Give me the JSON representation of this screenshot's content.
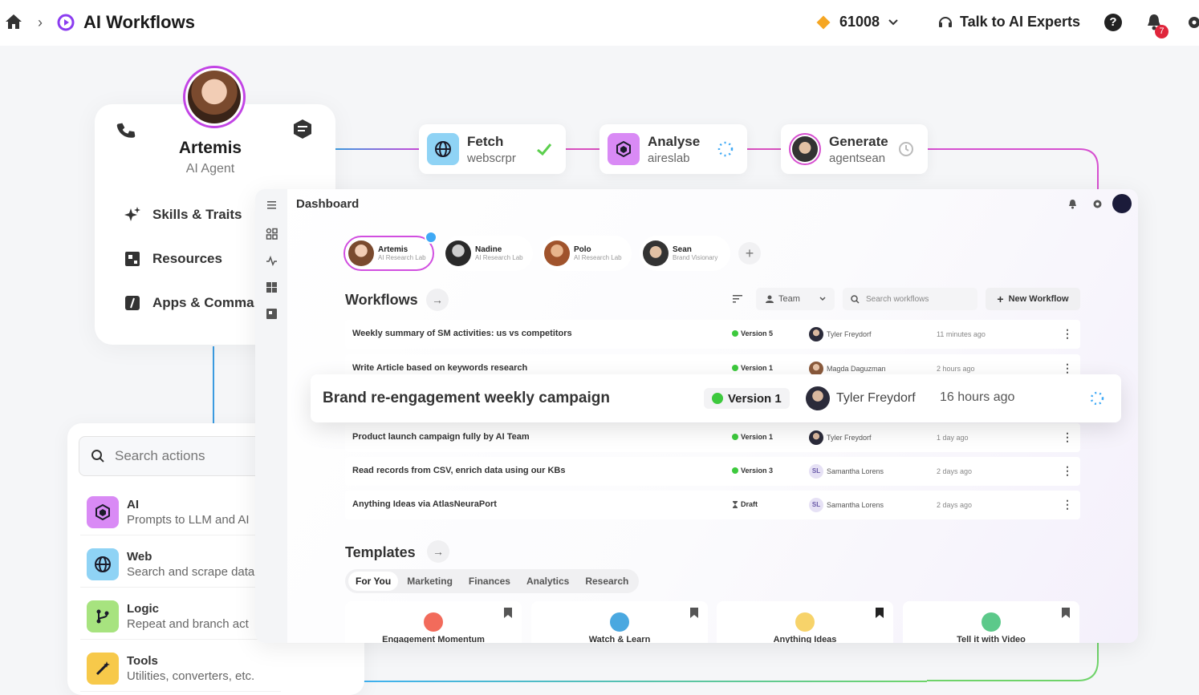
{
  "topbar": {
    "title": "AI Workflows",
    "credits": "61008",
    "talk_label": "Talk to AI Experts",
    "notification_count": "7"
  },
  "agent": {
    "name": "Artemis",
    "role": "AI Agent",
    "menu": [
      {
        "label": "Skills & Traits",
        "icon": "sparkles-icon"
      },
      {
        "label": "Resources",
        "icon": "resources-icon"
      },
      {
        "label": "Apps & Comma",
        "icon": "apps-icon"
      }
    ]
  },
  "flow": {
    "nodes": [
      {
        "name": "Fetch",
        "sub": "webscrpr",
        "status": "done",
        "color": "#6ec6f0"
      },
      {
        "name": "Analyse",
        "sub": "aireslab",
        "status": "running",
        "color": "#c86af0"
      },
      {
        "name": "Generate",
        "sub": "agentsean",
        "status": "pending",
        "color": "#ffffff"
      }
    ]
  },
  "actions": {
    "search_placeholder": "Search actions",
    "items": [
      {
        "name": "AI",
        "desc": "Prompts to LLM and AI",
        "color": "#d98af5",
        "icon": "cube-icon"
      },
      {
        "name": "Web",
        "desc": "Search and scrape data",
        "color": "#8fd3f5",
        "icon": "globe-icon"
      },
      {
        "name": "Logic",
        "desc": "Repeat and branch act",
        "color": "#a7e37f",
        "icon": "branch-icon"
      },
      {
        "name": "Tools",
        "desc": "Utilities, converters, etc.",
        "color": "#f7c94a",
        "icon": "wand-icon"
      }
    ]
  },
  "dashboard": {
    "title": "Dashboard",
    "agents": [
      {
        "name": "Artemis",
        "org": "AI Research Lab",
        "active": true
      },
      {
        "name": "Nadine",
        "org": "AI Research Lab",
        "active": false
      },
      {
        "name": "Polo",
        "org": "AI Research Lab",
        "active": false
      },
      {
        "name": "Sean",
        "org": "Brand Visionary",
        "active": false
      }
    ],
    "add_agent": "+",
    "workflows_title": "Workflows",
    "team_label": "Team",
    "search_placeholder": "Search workflows",
    "new_workflow": "New Workflow",
    "workflows": [
      {
        "name": "Weekly summary of SM activities: us vs competitors",
        "version": "Version 5",
        "user": "Tyler Freydorf",
        "time": "11 minutes ago",
        "draft": false
      },
      {
        "name": "Write Article based on keywords research",
        "version": "Version 1",
        "user": "Magda Daguzman",
        "time": "2 hours ago",
        "draft": false
      },
      {
        "name": "Product launch campaign fully by AI Team",
        "version": "Version 1",
        "user": "Tyler Freydorf",
        "time": "1 day ago",
        "draft": false
      },
      {
        "name": "Read records from CSV, enrich data using our KBs",
        "version": "Version 3",
        "user": "Samantha Lorens",
        "initials": "SL",
        "time": "2 days ago",
        "draft": false
      },
      {
        "name": "Anything Ideas via AtlasNeuraPort",
        "version": "Draft",
        "user": "Samantha Lorens",
        "initials": "SL",
        "time": "2 days ago",
        "draft": true
      }
    ],
    "highlight": {
      "name": "Brand re-engagement weekly campaign",
      "version": "Version 1",
      "user": "Tyler Freydorf",
      "time": "16 hours ago"
    },
    "templates_title": "Templates",
    "tabs": [
      "For You",
      "Marketing",
      "Finances",
      "Analytics",
      "Research"
    ],
    "templates": [
      {
        "name": "Engagement Momentum",
        "color": "#f26b5b"
      },
      {
        "name": "Watch & Learn",
        "color": "#4aa8e0"
      },
      {
        "name": "Anything Ideas",
        "color": "#f7d36a"
      },
      {
        "name": "Tell it with Video",
        "color": "#5cc98a"
      }
    ]
  }
}
